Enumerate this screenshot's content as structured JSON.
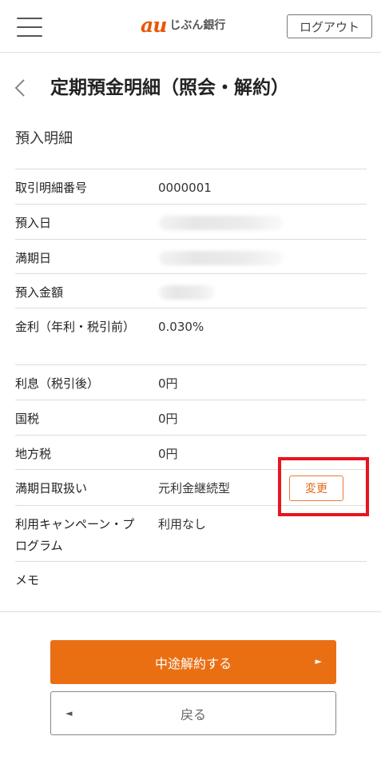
{
  "header": {
    "logo_brand": "au",
    "logo_bank": "じぶん銀行",
    "logout_label": "ログアウト",
    "menu_icon": "hamburger-menu-icon",
    "accent_color": "#eb5505"
  },
  "page": {
    "title": "定期預金明細（照会・解約）",
    "back_icon": "chevron-left-icon"
  },
  "section": {
    "title": "預入明細"
  },
  "details": {
    "rows": [
      {
        "label": "取引明細番号",
        "value": "0000001"
      },
      {
        "label": "預入日",
        "value": ""
      },
      {
        "label": "満期日",
        "value": ""
      },
      {
        "label": "預入金額",
        "value": ""
      },
      {
        "label": "金利（年利・税引前）",
        "value": "0.030%"
      },
      {
        "label": "利息（税引後）",
        "value": "0円"
      },
      {
        "label": "国税",
        "value": "0円"
      },
      {
        "label": "地方税",
        "value": "0円"
      },
      {
        "label": "満期日取扱い",
        "value": "元利金継続型",
        "action_label": "変更"
      },
      {
        "label": "利用キャンペーン・プログラム",
        "value": "利用なし"
      },
      {
        "label": "メモ",
        "value": ""
      }
    ]
  },
  "actions": {
    "cancel_label": "中途解約する",
    "back_label": "戻る",
    "primary_color": "#ea6f13",
    "highlight_color": "#e8141e"
  }
}
